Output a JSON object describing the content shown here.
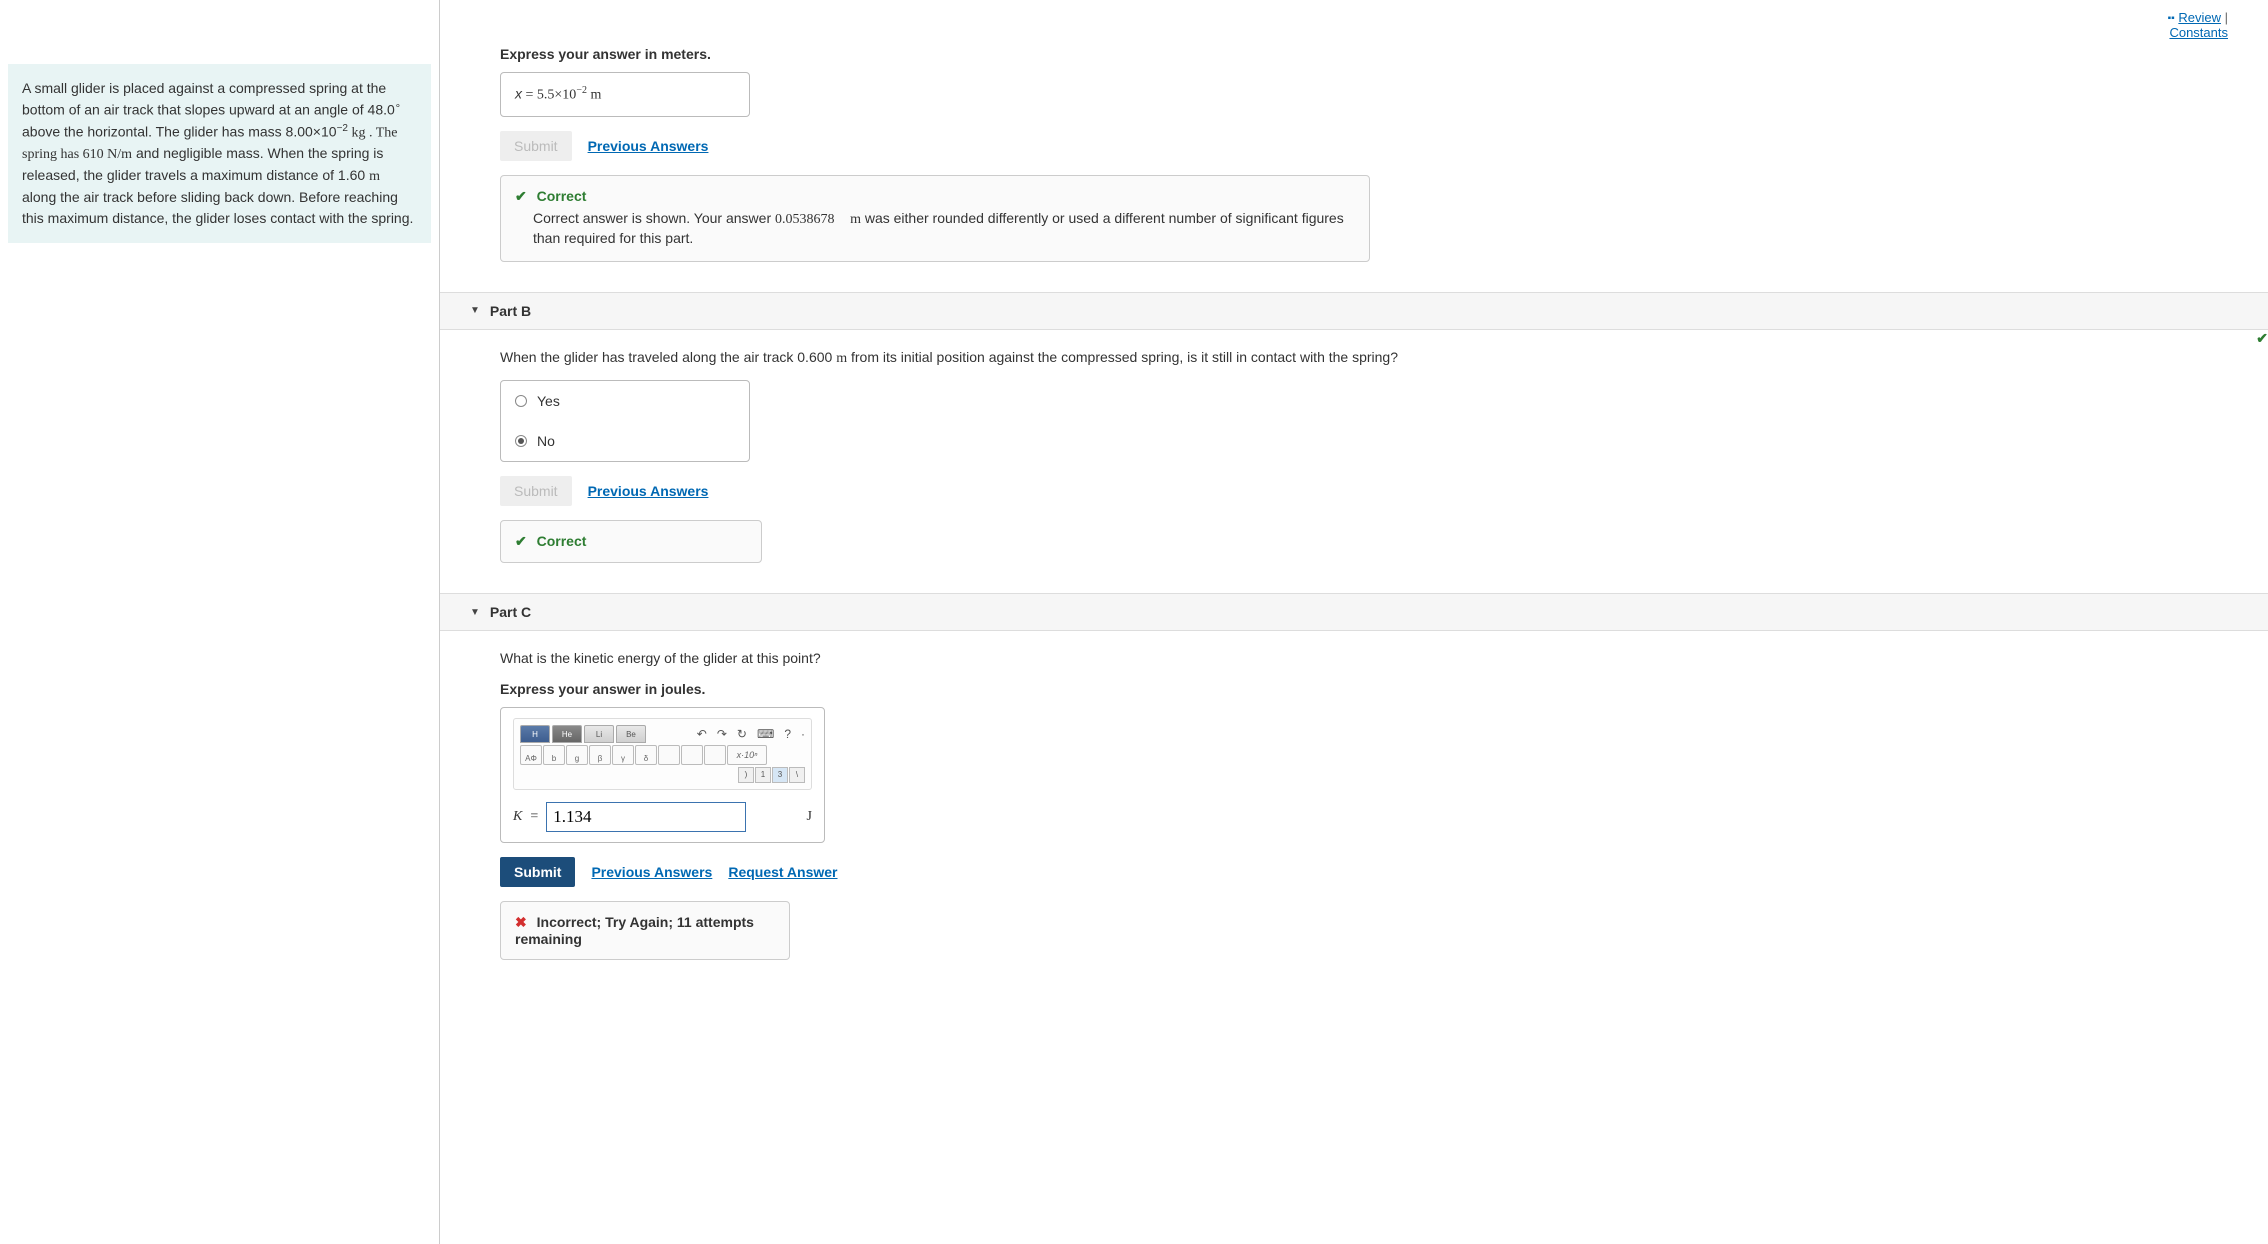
{
  "top_links": {
    "review": "Review",
    "sep": "|",
    "constants": "Constants"
  },
  "problem_statement": {
    "p1a": "A small glider is placed against a compressed spring at the bottom of an air track that slopes upward at an angle of 48.0",
    "p1b": " above the horizontal. The glider has mass 8.00×10",
    "p1c": " kg . The spring has 610 ",
    "p1d": "  and negligible mass. When the spring is released, the glider travels a maximum distance of 1.60 ",
    "p1e": "  along the air track before sliding back down. Before reaching this maximum distance, the glider loses contact with the spring.",
    "deg": "∘",
    "exp_neg2": "−2",
    "nm": "N/m",
    "m": "m"
  },
  "part_a": {
    "instruction": "Express your answer in meters.",
    "answer_prefix": "x",
    "answer_eq": " = ",
    "answer_val": "5.5×10",
    "answer_exp": "−2",
    "answer_unit": " m",
    "submit": "Submit",
    "previous": "Previous Answers",
    "fb_title": "Correct",
    "fb_detail_a": "Correct answer is shown. Your answer ",
    "fb_detail_val": "0.0538678",
    "fb_detail_unit": "m",
    "fb_detail_b": " was either rounded differently or used a different number of significant figures than required for this part."
  },
  "part_b": {
    "header": "Part B",
    "question_a": "When the glider has traveled along the air track 0.600 ",
    "question_unit": "m",
    "question_b": "  from its initial position against the compressed spring, is it still in contact with the spring?",
    "yes": "Yes",
    "no": "No",
    "submit": "Submit",
    "previous": "Previous Answers",
    "fb_title": "Correct"
  },
  "part_c": {
    "header": "Part C",
    "question": "What is the kinetic energy of the glider at this point?",
    "instruction": "Express your answer in joules.",
    "var": "K",
    "eq": " = ",
    "value": "1.134",
    "unit": "J",
    "submit": "Submit",
    "previous": "Previous Answers",
    "request": "Request Answer",
    "fb_title": "Incorrect; Try Again; 11 attempts remaining",
    "sci_label": "x·10ⁿ",
    "tabs": {
      "h": "H",
      "he": "He",
      "li": "Li",
      "be": "Be"
    },
    "greek": {
      "b": "β",
      "g": "γ",
      "d": "δ",
      "ao": "AΦ",
      "bb": "b",
      "gg": "g"
    }
  }
}
